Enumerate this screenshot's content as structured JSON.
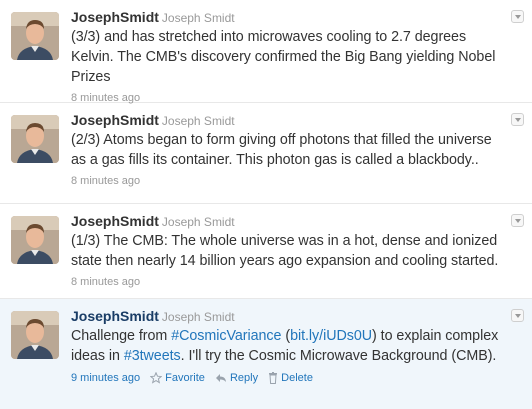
{
  "tweets": [
    {
      "screen_name": "JosephSmidt",
      "full_name": "Joseph Smidt",
      "text": "(3/3) and has stretched into microwaves cooling to 2.7 degrees Kelvin. The CMB's discovery confirmed the Big Bang yielding Nobel Prizes",
      "timestamp": "8 minutes ago"
    },
    {
      "screen_name": "JosephSmidt",
      "full_name": "Joseph Smidt",
      "text": "(2/3) Atoms began to form giving off photons that filled the universe as a gas fills its container. This photon gas is called a blackbody..",
      "timestamp": "8 minutes ago"
    },
    {
      "screen_name": "JosephSmidt",
      "full_name": "Joseph Smidt",
      "text": "(1/3) The CMB: The whole universe was in a hot, dense and ionized state then nearly 14 billion years ago expansion and cooling started.",
      "timestamp": "8 minutes ago"
    },
    {
      "screen_name": "JosephSmidt",
      "full_name": "Joseph Smidt",
      "text_parts": {
        "p1": "Challenge from ",
        "link1": "#CosmicVariance",
        "p2": " (",
        "link2": "bit.ly/iUDs0U",
        "p3": ") to explain complex ideas in ",
        "link3": "#3tweets",
        "p4": ". I'll try the Cosmic Microwave Background (CMB)."
      },
      "timestamp": "9 minutes ago",
      "actions": {
        "favorite": "Favorite",
        "reply": "Reply",
        "delete": "Delete"
      }
    }
  ],
  "colors": {
    "link": "#2276bb",
    "highlight_bg": "#f0f6fb",
    "muted": "#999999"
  }
}
